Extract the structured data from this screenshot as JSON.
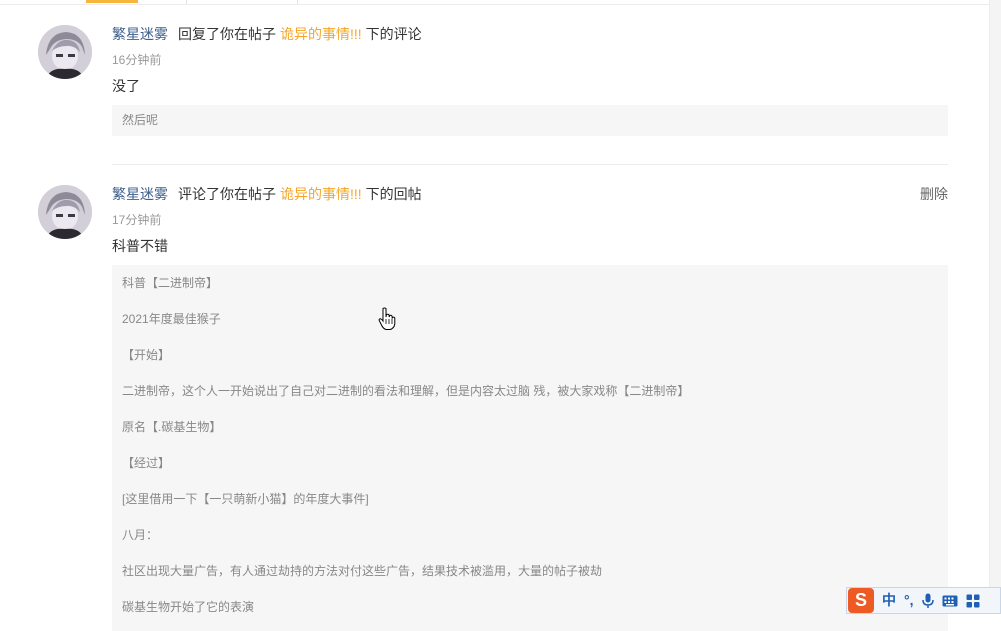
{
  "notifications": [
    {
      "user": "繁星迷雾",
      "action": "回复了你在帖子",
      "post_title": "诡异的事情!!!",
      "suffix": "下的评论",
      "time": "16分钟前",
      "text": "没了",
      "quote": [
        "然后呢"
      ]
    },
    {
      "user": "繁星迷雾",
      "action": "评论了你在帖子",
      "post_title": "诡异的事情!!!",
      "suffix": "下的回帖",
      "time": "17分钟前",
      "text": "科普不错",
      "delete_label": "删除",
      "quote": [
        "科普【二进制帝】",
        "2021年度最佳猴子",
        "【开始】",
        "二进制帝，这个人一开始说出了自己对二进制的看法和理解，但是内容太过脑 残，被大家戏称【二进制帝】",
        "原名【.碳基生物】",
        "【经过】",
        "[这里借用一下【一只萌新小猫】的年度大事件]",
        "八月：",
        "社区出现大量广告，有人通过劫持的方法对付这些广告，结果技术被滥用，大量的帖子被劫",
        "碳基生物开始了它的表演"
      ]
    }
  ],
  "ime_bar": {
    "logo": "S",
    "mode": "中",
    "punct": "°,"
  },
  "colors": {
    "accent": "#f6a623",
    "username": "#3c5e8c",
    "quote_bg": "#f6f6f6",
    "ime_logo": "#ee5a24"
  },
  "icons": [
    "avatar",
    "hand-cursor-icon",
    "microphone-icon",
    "keyboard-icon",
    "grid-icon"
  ]
}
